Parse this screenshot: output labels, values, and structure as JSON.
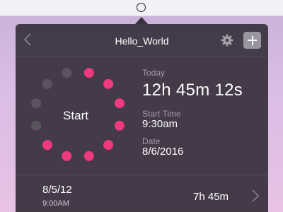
{
  "header": {
    "title": "Hello_World"
  },
  "timer": {
    "start_label": "Start",
    "dots": {
      "active": 8,
      "total": 12
    }
  },
  "info": {
    "today_label": "Today",
    "today_value": "12h 45m 12s",
    "start_time_label": "Start Time",
    "start_time_value": "9:30am",
    "date_label": "Date",
    "date_value": "8/6/2016"
  },
  "history": [
    {
      "date": "8/5/12",
      "time": "9:00AM",
      "duration": "7h 45m"
    }
  ],
  "colors": {
    "accent": "#f0397e",
    "inactive_dot": "#5b5360",
    "popover": "#372f3c",
    "muted_text": "#a39aa7"
  },
  "icons": {
    "tray": "circle-icon",
    "back": "chevron-left-icon",
    "settings": "gear-icon",
    "add": "plus-icon",
    "row": "chevron-right-icon"
  }
}
